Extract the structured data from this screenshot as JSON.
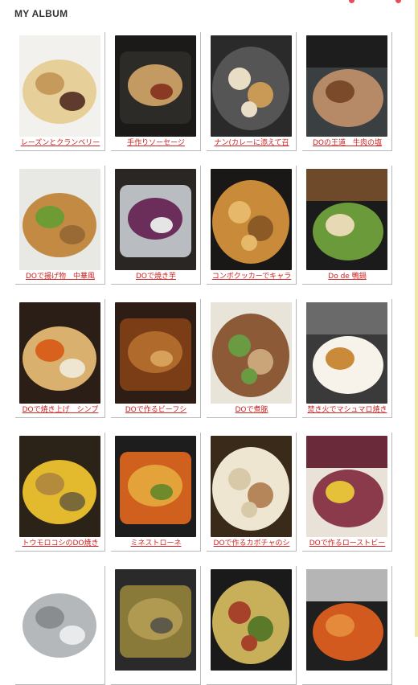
{
  "album": {
    "title": "MY ALBUM",
    "items": [
      {
        "caption": "レーズンとクランベリー",
        "icon": "scones-photo-icon",
        "colors": [
          "#f3f1ee",
          "#e7cf9a",
          "#c69a5a",
          "#5e3b2c"
        ]
      },
      {
        "caption": "手作りソーセージ",
        "icon": "sausage-photo-icon",
        "colors": [
          "#1c1a18",
          "#2d2b27",
          "#c49a63",
          "#8a3a22"
        ]
      },
      {
        "caption": "ナン(カレーに添えて召",
        "icon": "naan-photo-icon",
        "colors": [
          "#2a2a2a",
          "#555555",
          "#e9ddc6",
          "#c99a55"
        ]
      },
      {
        "caption": "DOの王道　牛肉の塩",
        "icon": "roast-beef-photo-icon",
        "colors": [
          "#3a3f42",
          "#1d1d1d",
          "#b68a67",
          "#7a4a2a"
        ]
      },
      {
        "caption": "DOで揚げ物　中華風",
        "icon": "fried-chicken-photo-icon",
        "colors": [
          "#e8e8e5",
          "#c28a42",
          "#6f9b35",
          "#9a6a35"
        ]
      },
      {
        "caption": "DOで焼き芋",
        "icon": "sweet-potato-photo-icon",
        "colors": [
          "#2a2624",
          "#b9bcc0",
          "#6b2e5a",
          "#e5e5e5"
        ]
      },
      {
        "caption": "コンボクッカーでキャラ",
        "icon": "popcorn-photo-icon",
        "colors": [
          "#1a1816",
          "#c98b3a",
          "#e6b86a",
          "#8c5a24"
        ]
      },
      {
        "caption": "Do de 鴨鍋",
        "icon": "duck-hotpot-photo-icon",
        "colors": [
          "#1b1b1b",
          "#6f4a2a",
          "#6a9a3a",
          "#e8d9b5"
        ]
      },
      {
        "caption": "DOで焼き上げ　シンプ",
        "icon": "roast-chicken-photo-icon",
        "colors": [
          "#2a1e16",
          "#d9b06d",
          "#d9611e",
          "#eee6d0"
        ]
      },
      {
        "caption": "DOで作るビーフシ",
        "icon": "beef-stew-photo-icon",
        "colors": [
          "#2d1d14",
          "#7a3d16",
          "#b06a2c",
          "#d7a15a"
        ]
      },
      {
        "caption": "DOで煮豚",
        "icon": "braised-pork-photo-icon",
        "colors": [
          "#e9e4da",
          "#8c5a36",
          "#6a9a42",
          "#caa57a"
        ]
      },
      {
        "caption": "焚き火でマシュマロ焼き",
        "icon": "marshmallow-photo-icon",
        "colors": [
          "#3a3a3a",
          "#6a6a6a",
          "#f7f3ea",
          "#c98a3a"
        ]
      },
      {
        "caption": "トウモロコシのDO焼き",
        "icon": "corn-photo-icon",
        "colors": [
          "#2b2218",
          "#e3b92e",
          "#b48b3c",
          "#7a6a3a"
        ]
      },
      {
        "caption": "ミネストローネ",
        "icon": "minestrone-photo-icon",
        "colors": [
          "#1d1d1d",
          "#d0601e",
          "#e4a23a",
          "#6e8a2a"
        ]
      },
      {
        "caption": "DOで作るカボチャのシ",
        "icon": "pumpkin-soup-photo-icon",
        "colors": [
          "#3a2a1a",
          "#efe6d2",
          "#d8c9a8",
          "#b5865a"
        ]
      },
      {
        "caption": "DOで作るローストビー",
        "icon": "roast-beef-slices-photo-icon",
        "colors": [
          "#e8e2d8",
          "#6a2a3a",
          "#8a3a4a",
          "#e5c13a"
        ]
      },
      {
        "caption": "",
        "icon": "measuring-spoons-photo-icon",
        "colors": [
          "#ffffff",
          "#b5b8bb",
          "#8a8d90",
          "#e8eaec"
        ]
      },
      {
        "caption": "",
        "icon": "grilled-fish-photo-icon",
        "colors": [
          "#2a2a2a",
          "#8a7a3a",
          "#b09a52",
          "#5e5a4a"
        ]
      },
      {
        "caption": "",
        "icon": "pizza-photo-icon",
        "colors": [
          "#1a1a1a",
          "#c8b05a",
          "#a6412a",
          "#5a7a2a"
        ]
      },
      {
        "caption": "",
        "icon": "shrimp-pot-photo-icon",
        "colors": [
          "#1f1f1f",
          "#b5b5b5",
          "#d25a1e",
          "#e58a3a"
        ]
      }
    ]
  }
}
